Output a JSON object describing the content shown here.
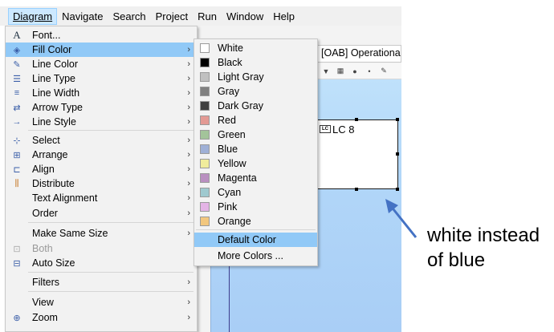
{
  "menubar": {
    "items": [
      {
        "label": "Diagram",
        "active": true
      },
      {
        "label": "Navigate"
      },
      {
        "label": "Search"
      },
      {
        "label": "Project"
      },
      {
        "label": "Run"
      },
      {
        "label": "Window"
      },
      {
        "label": "Help"
      }
    ]
  },
  "editor": {
    "tab_title": "[OAB] Operational",
    "node_label": "LC 8",
    "node_icon_text": "LC"
  },
  "diagram_menu": {
    "items": [
      {
        "label": "Font...",
        "icon": "font-icon"
      },
      {
        "label": "Fill Color",
        "icon": "fill-bucket-icon",
        "submenu": true,
        "highlighted": true
      },
      {
        "label": "Line Color",
        "icon": "pen-icon",
        "submenu": true
      },
      {
        "label": "Line Type",
        "icon": "line-type-icon",
        "submenu": true
      },
      {
        "label": "Line Width",
        "icon": "line-width-icon",
        "submenu": true
      },
      {
        "label": "Arrow Type",
        "icon": "arrow-type-icon",
        "submenu": true
      },
      {
        "label": "Line Style",
        "icon": "line-style-icon",
        "submenu": true
      },
      {
        "label": "Select",
        "icon": "select-icon",
        "submenu": true
      },
      {
        "label": "Arrange",
        "icon": "arrange-icon",
        "submenu": true
      },
      {
        "label": "Align",
        "icon": "align-icon",
        "submenu": true
      },
      {
        "label": "Distribute",
        "icon": "distribute-icon",
        "submenu": true
      },
      {
        "label": "Text Alignment",
        "submenu": true
      },
      {
        "label": "Order",
        "submenu": true
      },
      {
        "label": "Make Same Size",
        "submenu": true
      },
      {
        "label": "Both",
        "icon": "same-size-both-icon",
        "disabled": true
      },
      {
        "label": "Auto Size",
        "icon": "auto-size-icon"
      },
      {
        "label": "Filters",
        "submenu": true
      },
      {
        "label": "View",
        "submenu": true
      },
      {
        "label": "Zoom",
        "icon": "zoom-icon",
        "submenu": true
      }
    ]
  },
  "fill_color_menu": {
    "items": [
      {
        "label": "White",
        "color": "#ffffff"
      },
      {
        "label": "Black",
        "color": "#000000"
      },
      {
        "label": "Light Gray",
        "color": "#c0c0c0"
      },
      {
        "label": "Gray",
        "color": "#808080"
      },
      {
        "label": "Dark Gray",
        "color": "#404040"
      },
      {
        "label": "Red",
        "color": "#e39a94"
      },
      {
        "label": "Green",
        "color": "#a3c49a"
      },
      {
        "label": "Blue",
        "color": "#9fb0d6"
      },
      {
        "label": "Yellow",
        "color": "#f0ec9c"
      },
      {
        "label": "Magenta",
        "color": "#b98fc0"
      },
      {
        "label": "Cyan",
        "color": "#9fc9cf"
      },
      {
        "label": "Pink",
        "color": "#e4b4e6"
      },
      {
        "label": "Orange",
        "color": "#f2c77e"
      },
      {
        "label": "Default Color",
        "highlighted": true
      },
      {
        "label": "More Colors ..."
      }
    ]
  },
  "annotation": {
    "line1": "white instead",
    "line2": "of blue",
    "arrow_color": "#4472c4"
  },
  "colors": {
    "highlight": "#91c9f7",
    "menu_bg": "#f2f2f2",
    "canvas": "#b1d6f8"
  }
}
